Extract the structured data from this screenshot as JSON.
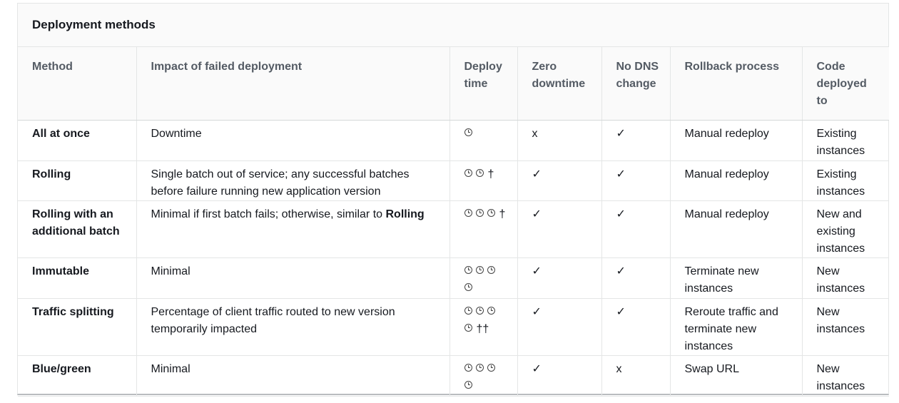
{
  "title": "Deployment methods",
  "columns": [
    "Method",
    "Impact of failed deployment",
    "Deploy time",
    "Zero downtime",
    "No DNS change",
    "Rollback process",
    "Code deployed to"
  ],
  "rows": [
    {
      "method": "All at once",
      "impact": "Downtime",
      "impact_bold": "",
      "clocks": 1,
      "dagger": "",
      "zero_downtime": "x",
      "no_dns_change": "✓",
      "rollback": "Manual redeploy",
      "code_deployed_to": "Existing instances"
    },
    {
      "method": "Rolling",
      "impact": "Single batch out of service; any successful batches before failure running new application version",
      "impact_bold": "",
      "clocks": 2,
      "dagger": "†",
      "zero_downtime": "✓",
      "no_dns_change": "✓",
      "rollback": "Manual redeploy",
      "code_deployed_to": "Existing instances"
    },
    {
      "method": "Rolling with an additional batch",
      "impact": "Minimal if first batch fails; otherwise, similar to ",
      "impact_bold": "Rolling",
      "clocks": 3,
      "dagger": "†",
      "zero_downtime": "✓",
      "no_dns_change": "✓",
      "rollback": "Manual redeploy",
      "code_deployed_to": "New and existing instances"
    },
    {
      "method": "Immutable",
      "impact": "Minimal",
      "impact_bold": "",
      "clocks": 4,
      "dagger": "",
      "zero_downtime": "✓",
      "no_dns_change": "✓",
      "rollback": "Terminate new instances",
      "code_deployed_to": "New instances"
    },
    {
      "method": "Traffic splitting",
      "impact": "Percentage of client traffic routed to new version temporarily impacted",
      "impact_bold": "",
      "clocks": 4,
      "dagger": "††",
      "zero_downtime": "✓",
      "no_dns_change": "✓",
      "rollback": "Reroute traffic and terminate new instances",
      "code_deployed_to": "New instances"
    },
    {
      "method": "Blue/green",
      "impact": "Minimal",
      "impact_bold": "",
      "clocks": 4,
      "dagger": "",
      "zero_downtime": "✓",
      "no_dns_change": "x",
      "rollback": "Swap URL",
      "code_deployed_to": "New instances"
    }
  ]
}
